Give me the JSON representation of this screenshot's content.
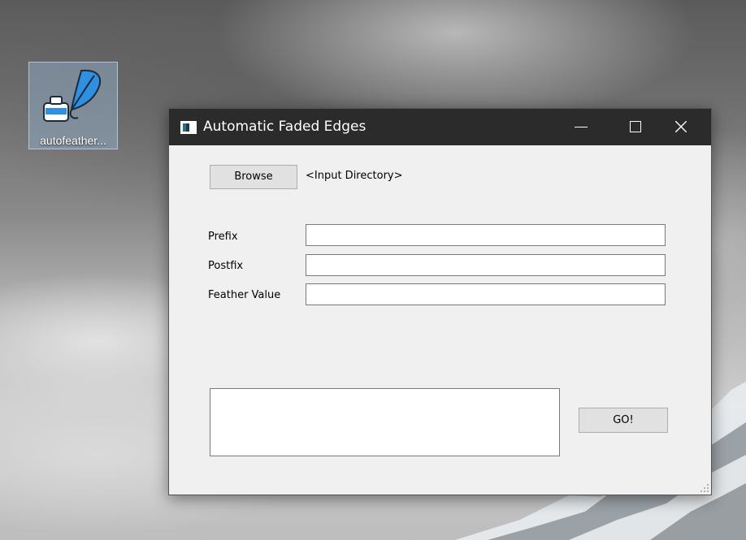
{
  "desktop": {
    "icons": [
      {
        "label": "autofeather..."
      }
    ]
  },
  "window": {
    "title": "Automatic Faded Edges",
    "controls": {
      "minimize_icon": "minimize-icon",
      "maximize_icon": "maximize-icon",
      "close_icon": "close-icon"
    },
    "browse": {
      "button_label": "Browse",
      "directory_label": "<Input Directory>"
    },
    "fields": [
      {
        "label": "Prefix",
        "value": ""
      },
      {
        "label": "Postfix",
        "value": ""
      },
      {
        "label": "Feather Value",
        "value": ""
      }
    ],
    "log": {
      "value": ""
    },
    "go_button_label": "GO!"
  },
  "colors": {
    "titlebar": "#2b2b2b",
    "window_bg": "#f0f0f0",
    "button_bg": "#e1e1e1",
    "icon_accent": "#2f8fe0"
  }
}
